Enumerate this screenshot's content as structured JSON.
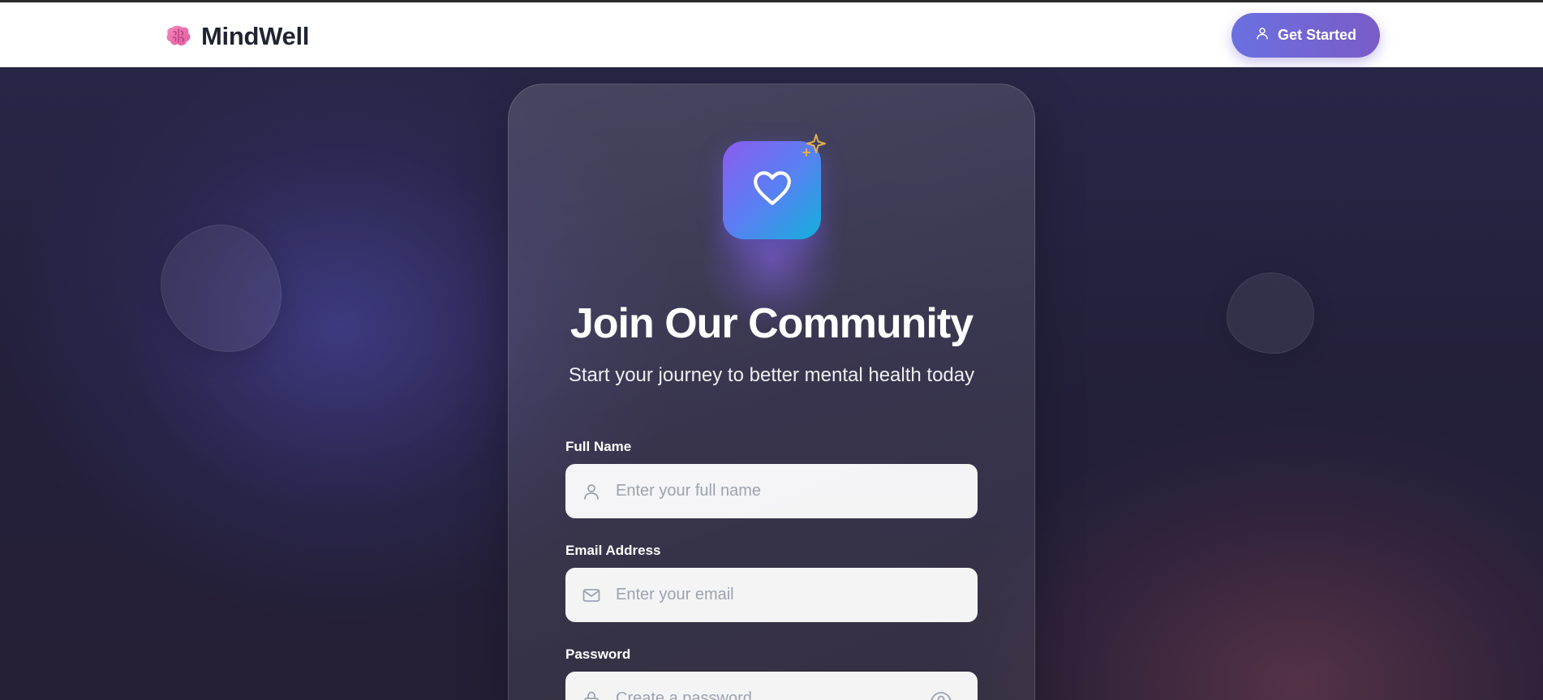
{
  "brand": {
    "name": "MindWell",
    "icon": "brain-icon"
  },
  "nav": {
    "cta_label": "Get Started",
    "cta_icon": "user-icon"
  },
  "hero": {
    "logo_icon": "heart-icon",
    "badge_icon": "sparkle-icon",
    "title": "Join Our Community",
    "subtitle": "Start your journey to better mental health today"
  },
  "form": {
    "full_name": {
      "label": "Full Name",
      "placeholder": "Enter your full name",
      "icon": "user-icon"
    },
    "email": {
      "label": "Email Address",
      "placeholder": "Enter your email",
      "icon": "mail-icon"
    },
    "password": {
      "label": "Password",
      "placeholder": "Create a password",
      "icon": "lock-icon",
      "toggle_icon": "eye-icon"
    }
  },
  "colors": {
    "accent_start": "#6b70e0",
    "accent_end": "#7a5cc7",
    "logo_gradient_start": "#8a5cf0",
    "logo_gradient_end": "#12b0dc",
    "sparkle": "#e0b24a",
    "brand_text": "#1f2433"
  }
}
